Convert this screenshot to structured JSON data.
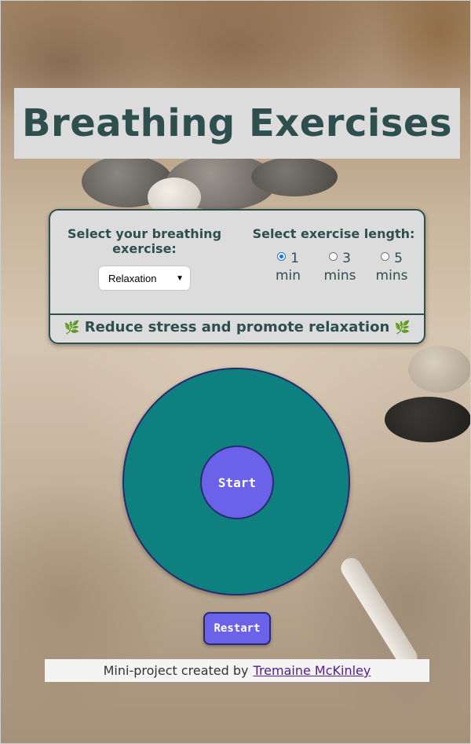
{
  "header": {
    "title": "Breathing Exercises"
  },
  "settings": {
    "exercise_label": "Select your breathing exercise:",
    "exercise_selected": "Relaxation",
    "length_label": "Select exercise length:",
    "length_options": [
      {
        "label": "1 min",
        "checked": true
      },
      {
        "label": "3 mins",
        "checked": false
      },
      {
        "label": "5 mins",
        "checked": false
      }
    ],
    "tagline": "Reduce stress and promote relaxation",
    "tagline_icon": "leaf-icon"
  },
  "breathing": {
    "start_label": "Start",
    "restart_label": "Restart"
  },
  "footer": {
    "text": "Mini-project created by",
    "author_link": "Tremaine McKinley"
  },
  "colors": {
    "title_text": "#2f4f4f",
    "circle": "#0e8080",
    "button": "#6a62e8",
    "border": "#2a2a6e"
  }
}
